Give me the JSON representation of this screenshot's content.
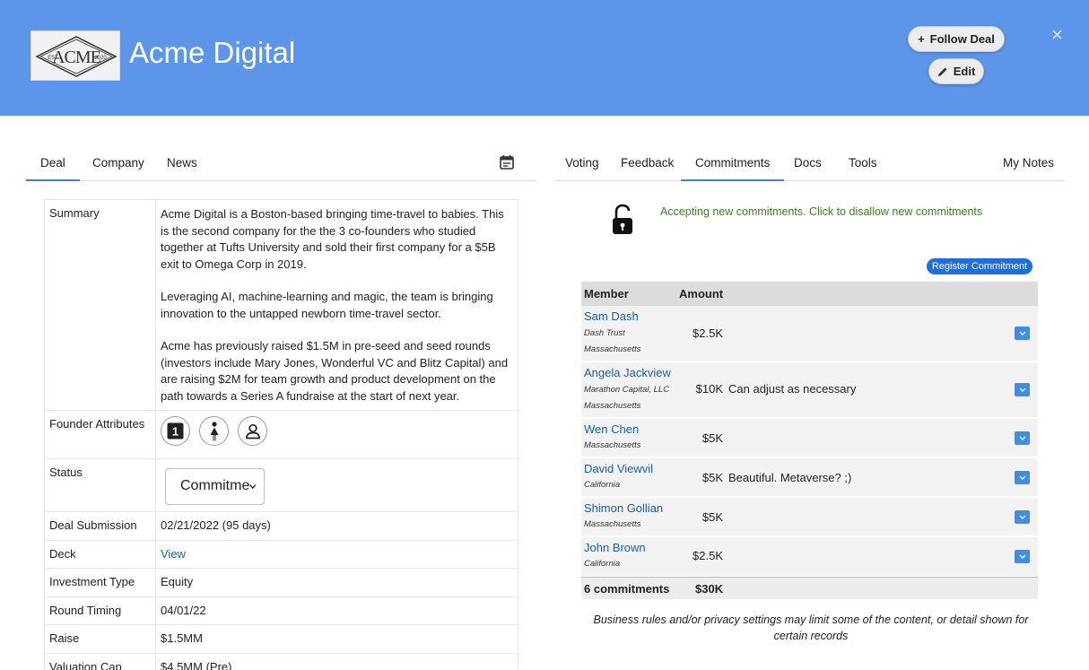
{
  "header": {
    "logo_text": "ACME",
    "logo_est": "EST",
    "logo_year": "2020",
    "company_name": "Acme Digital",
    "follow_label": "Follow Deal",
    "follow_icon": "+",
    "edit_label": "Edit",
    "close_icon": "×",
    "bg_color": "#5c95e9"
  },
  "left_tabs": [
    "Deal",
    "Company",
    "News"
  ],
  "right_tabs": [
    "Voting",
    "Feedback",
    "Commitments",
    "Docs",
    "Tools",
    "My Notes"
  ],
  "deal": {
    "summary_label": "Summary",
    "summary": [
      "Acme Digital is a Boston-based bringing time-travel to babies. This is the second company for the the 3 co-founders who studied together at Tufts University and sold their first company for a $5B exit to Omega Corp in 2019.",
      "Leveraging AI, machine-learning and magic, the team is bringing innovation to the untapped newborn time-travel sector.",
      "Acme has previously raised $1.5M in pre-seed and seed rounds (investors include Mary Jones, Wonderful VC and Blitz Capital) and are raising $2M for team growth and product development on the path towards a Series A fundraise at the start of next year."
    ],
    "founder_label": "Founder Attributes",
    "founder_icons": [
      "first-time-founder-icon",
      "female-founder-icon",
      "person-icon"
    ],
    "first_icon_text": "1",
    "status_label": "Status",
    "status_value": "Commitme",
    "rows": [
      {
        "label": "Deal Submission",
        "value": "02/21/2022 (95 days)"
      },
      {
        "label": "Deck",
        "value": "View"
      },
      {
        "label": "Investment Type",
        "value": "Equity"
      },
      {
        "label": "Round Timing",
        "value": "04/01/22"
      },
      {
        "label": "Raise",
        "value": "$1.5MM"
      },
      {
        "label": "Valuation Cap",
        "value": "$4.5MM (Pre)"
      }
    ]
  },
  "commitments": {
    "accepting_text": "Accepting new commitments.  Click to disallow new commitments",
    "register_label": "Register Commitment",
    "col_member": "Member",
    "col_amount": "Amount",
    "rows": [
      {
        "name": "Sam Dash",
        "entity": "Dash Trust",
        "state": "Massachusetts",
        "amount": "$2.5K",
        "note": ""
      },
      {
        "name": "Angela Jackview",
        "entity": "Marathon Capital, LLC",
        "state": "Massachusetts",
        "amount": "$10K",
        "note": "Can adjust as necessary"
      },
      {
        "name": "Wen Chen",
        "entity": "",
        "state": "Massachusetts",
        "amount": "$5K",
        "note": ""
      },
      {
        "name": "David Viewvil",
        "entity": "",
        "state": "California",
        "amount": "$5K",
        "note": "Beautiful. Metaverse? ;)"
      },
      {
        "name": "Shimon Gollian",
        "entity": "",
        "state": "Massachusetts",
        "amount": "$5K",
        "note": ""
      },
      {
        "name": "John Brown",
        "entity": "",
        "state": "California",
        "amount": "$2.5K",
        "note": ""
      }
    ],
    "total_count": "6 commitments",
    "total_amount": "$30K",
    "disclaimer": "Business rules and/or privacy settings may limit some of the content, or detail shown for certain records",
    "accent_green": "#2f8a12",
    "accent_blue": "#1e6ee2"
  }
}
